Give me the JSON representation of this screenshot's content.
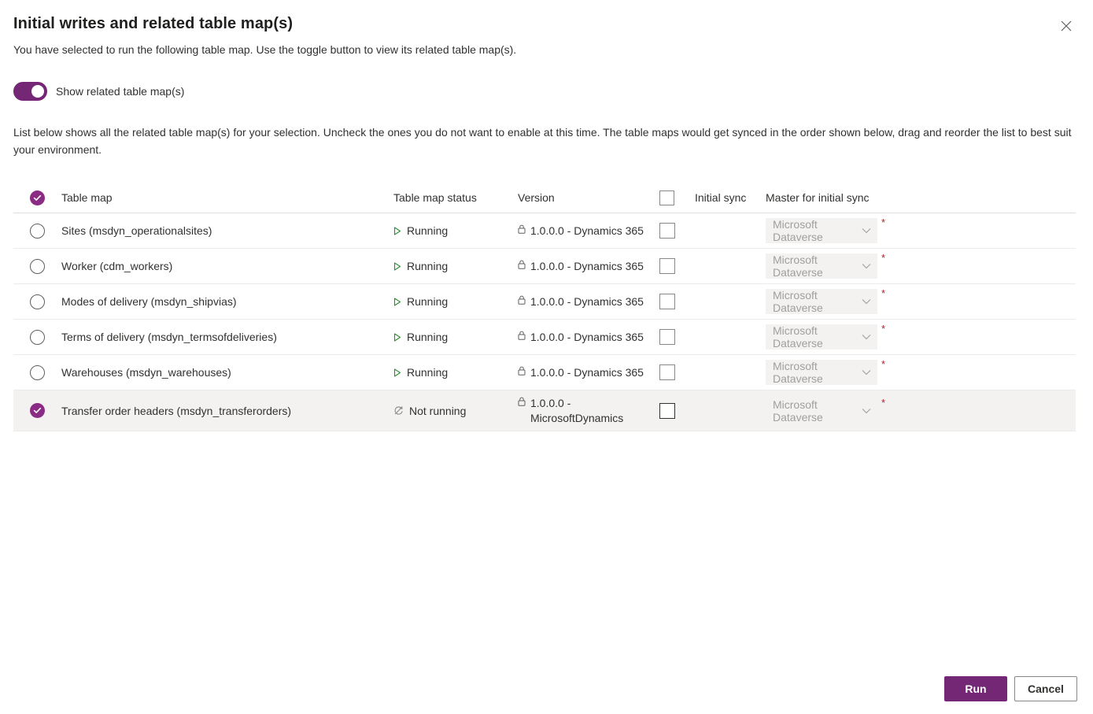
{
  "dialog": {
    "title": "Initial writes and related table map(s)",
    "subtitle": "You have selected to run the following table map. Use the toggle button to view its related table map(s).",
    "close_label": "Close",
    "description": "List below shows all the related table map(s) for your selection. Uncheck the ones you do not want to enable at this time. The table maps would get synced in the order shown below, drag and reorder the list to best suit your environment."
  },
  "toggle": {
    "label": "Show related table map(s)",
    "on": true
  },
  "table": {
    "columns": {
      "select": "",
      "name": "Table map",
      "status": "Table map status",
      "version": "Version",
      "initial_sync": "Initial sync",
      "master": "Master for initial sync"
    },
    "rows": [
      {
        "name": "Sites (msdyn_operationalsites)",
        "status": "Running",
        "status_icon": "play-icon",
        "version": "1.0.0.0 - Dynamics 365",
        "initial_sync_checked": false,
        "master": "Microsoft Dataverse",
        "required": "*",
        "selected": false
      },
      {
        "name": "Worker (cdm_workers)",
        "status": "Running",
        "status_icon": "play-icon",
        "version": "1.0.0.0 - Dynamics 365",
        "initial_sync_checked": false,
        "master": "Microsoft Dataverse",
        "required": "*",
        "selected": false
      },
      {
        "name": "Modes of delivery (msdyn_shipvias)",
        "status": "Running",
        "status_icon": "play-icon",
        "version": "1.0.0.0 - Dynamics 365",
        "initial_sync_checked": false,
        "master": "Microsoft Dataverse",
        "required": "*",
        "selected": false
      },
      {
        "name": "Terms of delivery (msdyn_termsofdeliveries)",
        "status": "Running",
        "status_icon": "play-icon",
        "version": "1.0.0.0 - Dynamics 365",
        "initial_sync_checked": false,
        "master": "Microsoft Dataverse",
        "required": "*",
        "selected": false
      },
      {
        "name": "Warehouses (msdyn_warehouses)",
        "status": "Running",
        "status_icon": "play-icon",
        "version": "1.0.0.0 - Dynamics 365",
        "initial_sync_checked": false,
        "master": "Microsoft Dataverse",
        "required": "*",
        "selected": false
      },
      {
        "name": "Transfer order headers (msdyn_transferorders)",
        "status": "Not running",
        "status_icon": "sync-disabled-icon",
        "version": "1.0.0.0 - MicrosoftDynamics",
        "initial_sync_checked": false,
        "master": "Microsoft Dataverse",
        "required": "*",
        "selected": true
      }
    ]
  },
  "footer": {
    "run_label": "Run",
    "cancel_label": "Cancel"
  },
  "colors": {
    "accent": "#742774",
    "check_circle": "#8A2B84",
    "running_green": "#2f8c34",
    "required_red": "#a4262c",
    "row_selected_bg": "#f3f2f1"
  }
}
